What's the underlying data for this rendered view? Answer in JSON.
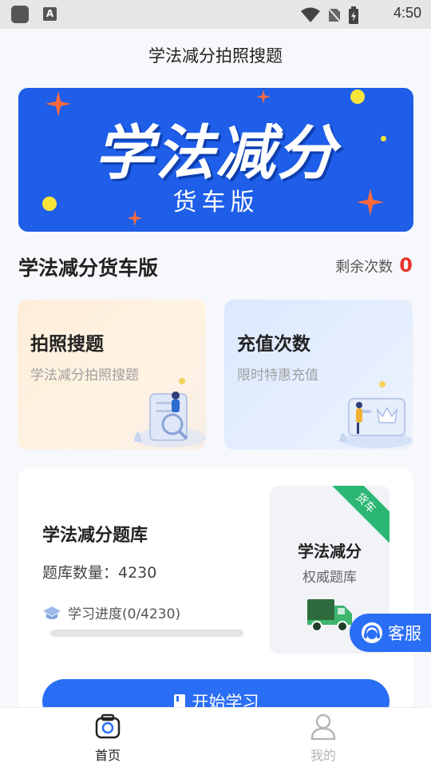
{
  "status_bar": {
    "time": "4:50",
    "app_letter": "A"
  },
  "header": {
    "title": "学法减分拍照搜题"
  },
  "banner": {
    "title": "学法减分",
    "subtitle": "货车版"
  },
  "section": {
    "title": "学法减分货车版",
    "remaining_label": "剩余次数",
    "remaining_value": "0"
  },
  "cards": [
    {
      "title": "拍照搜题",
      "subtitle": "学法减分拍照搜题"
    },
    {
      "title": "充值次数",
      "subtitle": "限时特惠充值"
    }
  ],
  "bank": {
    "title": "学法减分题库",
    "count_text": "题库数量：4230",
    "progress_text": "学习进度(0/4230)",
    "progress_fraction": 0,
    "badge_title": "学法减分",
    "badge_subtitle": "权威题库",
    "ribbon": "货车",
    "start_button": "开始学习"
  },
  "service": {
    "label": "客服"
  },
  "nav": [
    {
      "label": "首页",
      "icon": "camera-icon",
      "active": true
    },
    {
      "label": "我的",
      "icon": "user-icon",
      "active": false
    }
  ],
  "colors": {
    "primary": "#2a6ef5",
    "banner": "#1e5ee8",
    "accent_red": "#e8352b",
    "ribbon": "#2bb673"
  }
}
